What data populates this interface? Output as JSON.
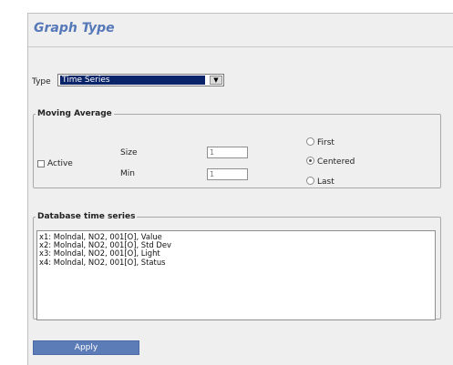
{
  "header": {
    "title": "Graph Type"
  },
  "type_field": {
    "label": "Type",
    "selected": "Time Series"
  },
  "moving_average": {
    "legend": "Moving Average",
    "active_label": "Active",
    "size_label": "Size",
    "size_value": "1",
    "min_label": "Min",
    "min_value": "1",
    "options": [
      {
        "label": "First",
        "selected": false
      },
      {
        "label": "Centered",
        "selected": true
      },
      {
        "label": "Last",
        "selected": false
      }
    ]
  },
  "database_series": {
    "legend": "Database time series",
    "items": [
      "x1: Molndal, NO2, 001[O], Value",
      "x2: Molndal, NO2, 001[O], Std Dev",
      "x3: Molndal, NO2, 001[O], Light",
      "x4: Molndal, NO2, 001[O], Status"
    ]
  },
  "footer": {
    "apply_label": "Apply"
  }
}
